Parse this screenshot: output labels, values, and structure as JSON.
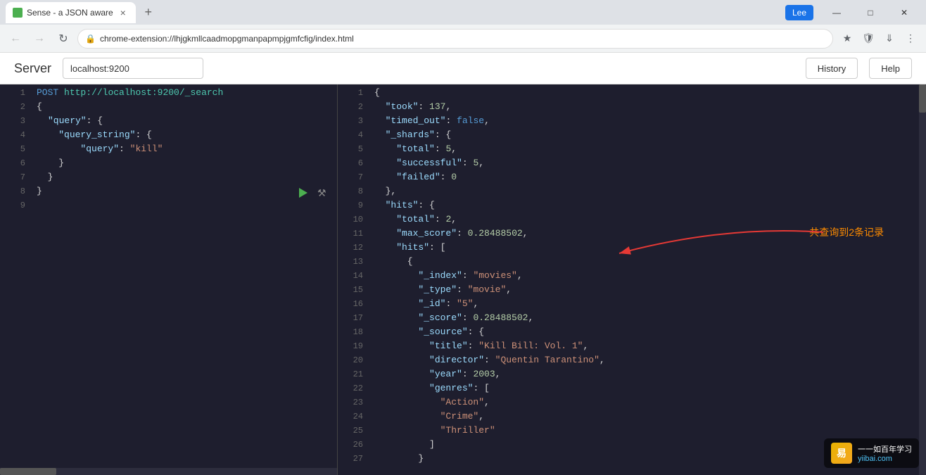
{
  "browser": {
    "tab_title": "Sense - a JSON aware",
    "tab_favicon_color": "#4CAF50",
    "address": "chrome-extension://lhjgkmllcaadmopgmanpapmpjgmfcfig/index.html",
    "user_name": "Lee"
  },
  "app": {
    "server_label": "Server",
    "server_value": "localhost:9200",
    "history_btn": "History",
    "help_btn": "Help"
  },
  "query_editor": {
    "lines": [
      {
        "num": "1",
        "content": "POST http://localhost:9200/_search"
      },
      {
        "num": "2",
        "content": "{"
      },
      {
        "num": "3",
        "content": "  \"query\": {"
      },
      {
        "num": "4",
        "content": "    \"query_string\": {"
      },
      {
        "num": "5",
        "content": "      \"query\": \"kill\""
      },
      {
        "num": "6",
        "content": "    }"
      },
      {
        "num": "7",
        "content": "  }"
      },
      {
        "num": "8",
        "content": "}"
      },
      {
        "num": "9",
        "content": ""
      }
    ]
  },
  "response": {
    "annotation": "共查询到2条记录",
    "lines": [
      {
        "num": "1",
        "content": "{"
      },
      {
        "num": "2",
        "content": "  \"took\": 137,"
      },
      {
        "num": "3",
        "content": "  \"timed_out\": false,"
      },
      {
        "num": "4",
        "content": "  \"_shards\": {"
      },
      {
        "num": "5",
        "content": "    \"total\": 5,"
      },
      {
        "num": "6",
        "content": "    \"successful\": 5,"
      },
      {
        "num": "7",
        "content": "    \"failed\": 0"
      },
      {
        "num": "8",
        "content": "  },"
      },
      {
        "num": "9",
        "content": "  \"hits\": {"
      },
      {
        "num": "10",
        "content": "    \"total\": 2,"
      },
      {
        "num": "11",
        "content": "    \"max_score\": 0.28488502,"
      },
      {
        "num": "12",
        "content": "    \"hits\": ["
      },
      {
        "num": "13",
        "content": "      {"
      },
      {
        "num": "14",
        "content": "        \"_index\": \"movies\","
      },
      {
        "num": "15",
        "content": "        \"_type\": \"movie\","
      },
      {
        "num": "16",
        "content": "        \"_id\": \"5\","
      },
      {
        "num": "17",
        "content": "        \"_score\": 0.28488502,"
      },
      {
        "num": "18",
        "content": "        \"_source\": {"
      },
      {
        "num": "19",
        "content": "          \"title\": \"Kill Bill: Vol. 1\","
      },
      {
        "num": "20",
        "content": "          \"director\": \"Quentin Tarantino\","
      },
      {
        "num": "21",
        "content": "          \"year\": 2003,"
      },
      {
        "num": "22",
        "content": "          \"genres\": ["
      },
      {
        "num": "23",
        "content": "            \"Action\","
      },
      {
        "num": "24",
        "content": "            \"Crime\","
      },
      {
        "num": "25",
        "content": "            \"Thriller\""
      },
      {
        "num": "26",
        "content": "          ]"
      },
      {
        "num": "27",
        "content": "        }"
      }
    ]
  },
  "watermark": {
    "logo": "易",
    "line1": "一一如百年学习",
    "site": "yiibai.com"
  }
}
